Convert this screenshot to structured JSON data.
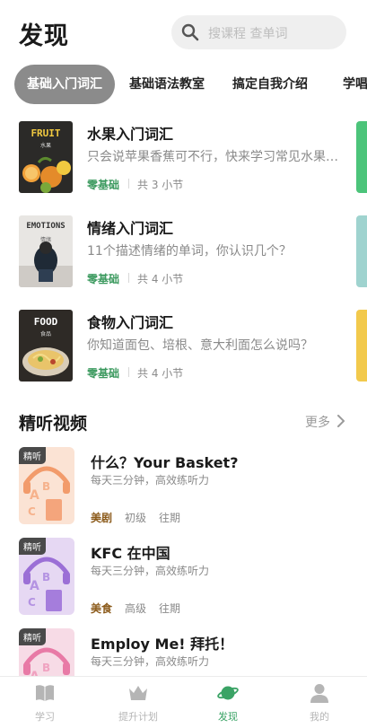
{
  "header": {
    "title": "发现",
    "search_placeholder": "搜课程 查单词"
  },
  "tabs": [
    {
      "label": "基础入门词汇",
      "active": true
    },
    {
      "label": "基础语法教室",
      "active": false
    },
    {
      "label": "搞定自我介绍",
      "active": false
    },
    {
      "label": "学唱",
      "active": false
    }
  ],
  "courses": [
    {
      "title": "水果入门词汇",
      "desc": "只会说苹果香蕉可不行，快来学习常见水果单词吧",
      "level": "零基础",
      "count": "共 3 小节",
      "cover_title": "FRUIT",
      "cover_sub": "水果"
    },
    {
      "title": "情绪入门词汇",
      "desc": "11个描述情绪的单词，你认识几个？",
      "level": "零基础",
      "count": "共 4 小节",
      "cover_title": "EMOTIONS",
      "cover_sub": "情绪"
    },
    {
      "title": "食物入门词汇",
      "desc": "你知道面包、培根、意大利面怎么说吗？",
      "level": "零基础",
      "count": "共 4 小节",
      "cover_title": "FOOD",
      "cover_sub": "食品"
    }
  ],
  "section": {
    "title": "精听视频",
    "more": "更多"
  },
  "videos": [
    {
      "badge": "精听",
      "title": "什么？Your Basket?",
      "desc": "每天三分钟，高效练听力",
      "tag": "美剧",
      "level": "初级",
      "period": "往期"
    },
    {
      "badge": "精听",
      "title": "KFC 在中国",
      "desc": "每天三分钟，高效练听力",
      "tag": "美食",
      "level": "高级",
      "period": "往期"
    },
    {
      "badge": "精听",
      "title": "Employ Me! 拜托！",
      "desc": "每天三分钟，高效练听力",
      "tag": "",
      "level": "",
      "period": ""
    }
  ],
  "tabbar": [
    {
      "label": "学习",
      "icon": "book-icon",
      "active": false
    },
    {
      "label": "提升计划",
      "icon": "crown-icon",
      "active": false
    },
    {
      "label": "发现",
      "icon": "planet-icon",
      "active": true
    },
    {
      "label": "我的",
      "icon": "person-icon",
      "active": false
    }
  ],
  "colors": {
    "accent_green": "#3aa365",
    "level_green": "#3c9a5f",
    "tag_brown": "#8b5a1a",
    "active_tab_bg": "#8b8b8b"
  }
}
